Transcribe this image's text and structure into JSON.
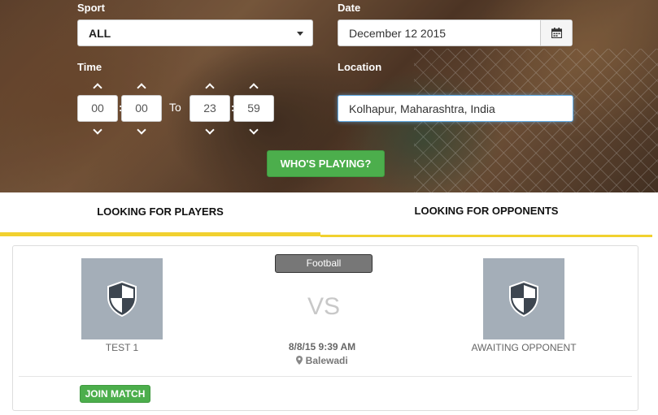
{
  "search": {
    "sport_label": "Sport",
    "sport_value": "ALL",
    "date_label": "Date",
    "date_value": "December 12 2015",
    "time_label": "Time",
    "time_from_hour": "00",
    "time_from_min": "00",
    "time_to_label": "To",
    "time_to_hour": "23",
    "time_to_min": "59",
    "time_sep": ":",
    "location_label": "Location",
    "location_value": "Kolhapur, Maharashtra, India",
    "submit_label": "WHO'S PLAYING?"
  },
  "tabs": [
    {
      "label": "LOOKING FOR PLAYERS",
      "active": true
    },
    {
      "label": "LOOKING FOR OPPONENTS",
      "active": false
    }
  ],
  "match": {
    "sport_badge": "Football",
    "home_team": "TEST 1",
    "vs_text": "VS",
    "away_team": "AWAITING OPPONENT",
    "datetime": "8/8/15 9:39 AM",
    "venue": "Balewadi",
    "join_label": "JOIN MATCH"
  },
  "colors": {
    "accent_yellow": "#f1d12f",
    "button_green": "#4cae4c",
    "crest_bg": "#a4aeb8"
  },
  "icons": [
    "calendar-icon",
    "chevron-up-icon",
    "chevron-down-icon",
    "caret-down-icon",
    "shield-icon",
    "map-marker-icon"
  ]
}
